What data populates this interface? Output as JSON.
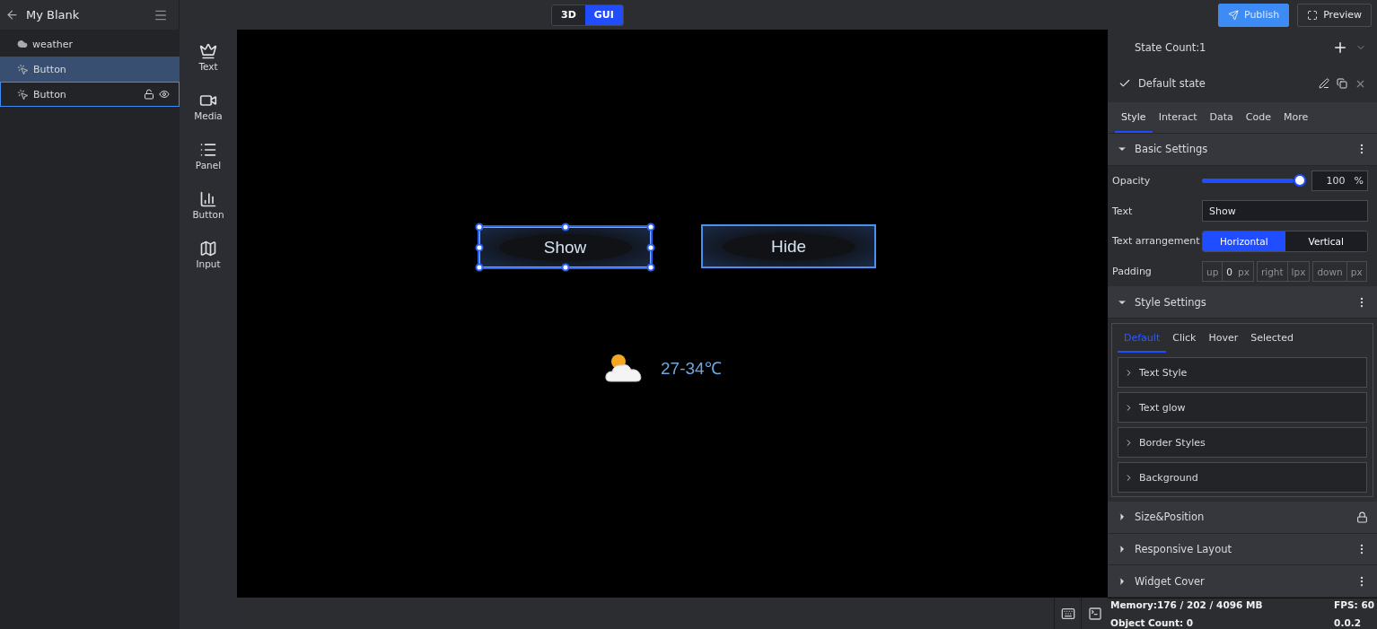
{
  "project": {
    "title": "My Blank"
  },
  "mode_switch": [
    {
      "label": "3D",
      "selected": false
    },
    {
      "label": "GUI",
      "selected": true
    }
  ],
  "actions": [
    {
      "kind": "publish",
      "label": "Publish"
    },
    {
      "kind": "preview",
      "label": "Preview"
    }
  ],
  "layers": [
    {
      "kind": "weather",
      "label": "weather",
      "selected": false,
      "hovered": false
    },
    {
      "kind": "button",
      "label": "Button",
      "selected": true,
      "hovered": false
    },
    {
      "kind": "button",
      "label": "Button",
      "selected": false,
      "hovered": true
    }
  ],
  "toolbox": [
    {
      "kind": "text",
      "label": "Text"
    },
    {
      "kind": "media",
      "label": "Media"
    },
    {
      "kind": "panel",
      "label": "Panel"
    },
    {
      "kind": "chart",
      "label": "Button"
    },
    {
      "kind": "map",
      "label": "Input"
    }
  ],
  "canvas": {
    "buttons": [
      {
        "label": "Show",
        "selected": true
      },
      {
        "label": "Hide",
        "selected": false
      }
    ],
    "weather": {
      "temperature": "27-34℃"
    }
  },
  "inspector": {
    "state_count": "State Count:1",
    "state": {
      "label": "Default state",
      "checked": true
    },
    "tabs": [
      {
        "label": "Style",
        "selected": true
      },
      {
        "label": "Interact",
        "selected": false
      },
      {
        "label": "Data",
        "selected": false
      },
      {
        "label": "Code",
        "selected": false
      },
      {
        "label": "More",
        "selected": false
      }
    ],
    "basic_settings": {
      "title": "Basic Settings",
      "expanded": true,
      "opacity": {
        "label": "Opacity",
        "level": 1,
        "value": "100",
        "unit": "%"
      },
      "text": {
        "label": "Text",
        "value": "Show"
      },
      "arrangement": {
        "label": "Text arrangement",
        "options": [
          {
            "label": "Horizontal",
            "selected": true
          },
          {
            "label": "Vertical",
            "selected": false
          }
        ]
      },
      "padding": {
        "label": "Padding",
        "fields": [
          {
            "label": "up",
            "value": "0",
            "unit": "px"
          },
          {
            "label": "right",
            "unit": "lpx"
          },
          {
            "label": "down",
            "unit": "px"
          }
        ]
      }
    },
    "style_settings": {
      "title": "Style Settings",
      "expanded": true,
      "tabs": [
        {
          "label": "Default",
          "selected": true
        },
        {
          "label": "Click",
          "selected": false
        },
        {
          "label": "Hover",
          "selected": false
        },
        {
          "label": "Selected",
          "selected": false
        }
      ],
      "groups": [
        "Text Style",
        "Text glow",
        "Border Styles",
        "Background"
      ]
    },
    "sections": [
      {
        "title": "Size&Position",
        "expanded": false,
        "kind": "lock"
      },
      {
        "title": "Responsive Layout",
        "expanded": false,
        "kind": "menu"
      },
      {
        "title": "Widget Cover",
        "expanded": false,
        "kind": "menu"
      }
    ]
  },
  "status": {
    "memory": "Memory:176 / 202 / 4096 MB",
    "fps": "FPS: 60",
    "objects": "Object Count: 0",
    "version": "0.0.2"
  }
}
